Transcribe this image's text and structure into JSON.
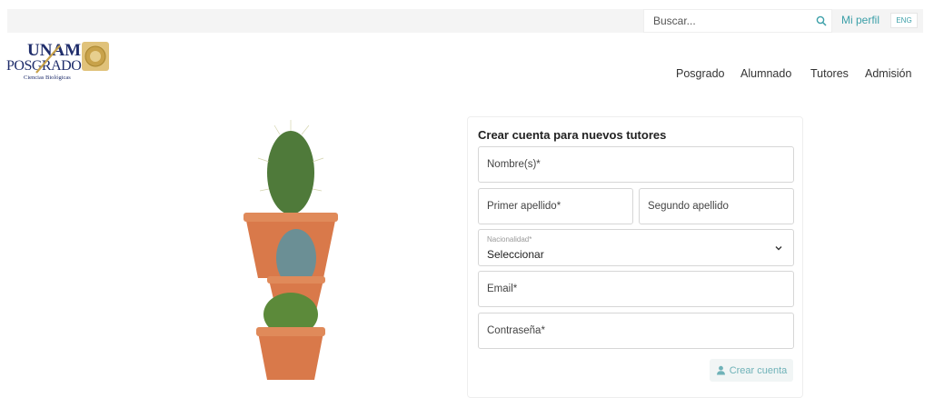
{
  "topbar": {
    "search_placeholder": "Buscar...",
    "search_icon": "search-icon",
    "profile_label": "Mi perfil",
    "lang_label": "ENG"
  },
  "logo": {
    "line1": "UNAM",
    "line2": "POSGRADO",
    "line3": "Ciencias Biológicas"
  },
  "nav": {
    "items": [
      "Posgrado",
      "Alumnado",
      "Tutores",
      "Admisión"
    ]
  },
  "form": {
    "title": "Crear cuenta para nuevos tutores",
    "nombre_placeholder": "Nombre(s)*",
    "primer_apellido_placeholder": "Primer apellido*",
    "segundo_apellido_placeholder": "Segundo apellido",
    "nacionalidad_label": "Nacionalidad*",
    "nacionalidad_value": "Seleccionar",
    "email_placeholder": "Email*",
    "password_placeholder": "Contraseña*",
    "submit_label": "Crear cuenta",
    "submit_icon": "user-icon"
  },
  "colors": {
    "accent": "#3b9fa8",
    "logo_blue": "#1f2d6b",
    "logo_gold": "#c8a24a",
    "pot": "#d9794a"
  }
}
